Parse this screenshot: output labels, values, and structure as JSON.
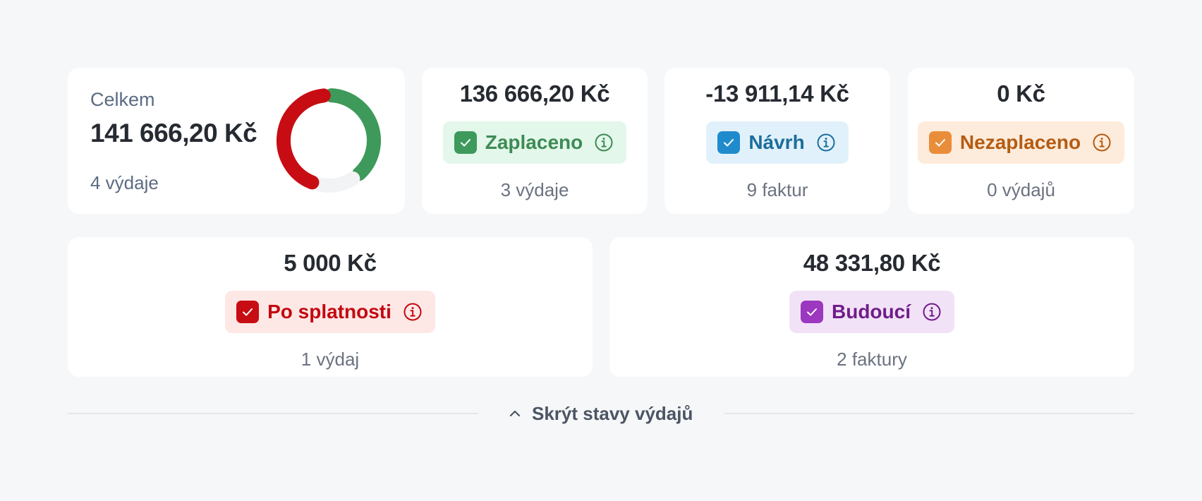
{
  "summary": {
    "label": "Celkem",
    "amount": "141 666,20 Kč",
    "count": "4 výdaje",
    "chart": {
      "type": "donut",
      "segments": [
        {
          "name": "paid",
          "share": 0.4,
          "color": "#3d9a5b"
        },
        {
          "name": "unallocated",
          "share": 0.15,
          "color": "#f1f3f5"
        },
        {
          "name": "overdue",
          "share": 0.45,
          "color": "#c70d13"
        }
      ]
    }
  },
  "statuses": [
    {
      "key": "zaplaceno",
      "amount": "136 666,20 Kč",
      "label": "Zaplaceno",
      "count": "3 výdaje",
      "color": "#3d8b55",
      "check_bg": "#3d9a5b",
      "badge_bg": "#e3f7ea",
      "checked": true
    },
    {
      "key": "navrh",
      "amount": "-13 911,14 Kč",
      "label": "Návrh",
      "count": "9 faktur",
      "color": "#1c6e9d",
      "check_bg": "#208bcc",
      "badge_bg": "#e1f1fb",
      "checked": true
    },
    {
      "key": "nezaplaceno",
      "amount": "0 Kč",
      "label": "Nezaplaceno",
      "count": "0 výdajů",
      "color": "#b55c12",
      "check_bg": "#ea8d3b",
      "badge_bg": "#fdebdb",
      "checked": true
    },
    {
      "key": "po-splatnosti",
      "amount": "5 000 Kč",
      "label": "Po splatnosti",
      "count": "1 výdaj",
      "color": "#c4080f",
      "check_bg": "#c70d13",
      "badge_bg": "#fde8e6",
      "checked": true
    },
    {
      "key": "budouci",
      "amount": "48 331,80 Kč",
      "label": "Budoucí",
      "count": "2 faktury",
      "color": "#6f1d8a",
      "check_bg": "#9c37bf",
      "badge_bg": "#f2e2f7",
      "checked": true
    }
  ],
  "toggle": {
    "label": "Skrýt stavy výdajů",
    "icon": "chevron-up-icon"
  }
}
